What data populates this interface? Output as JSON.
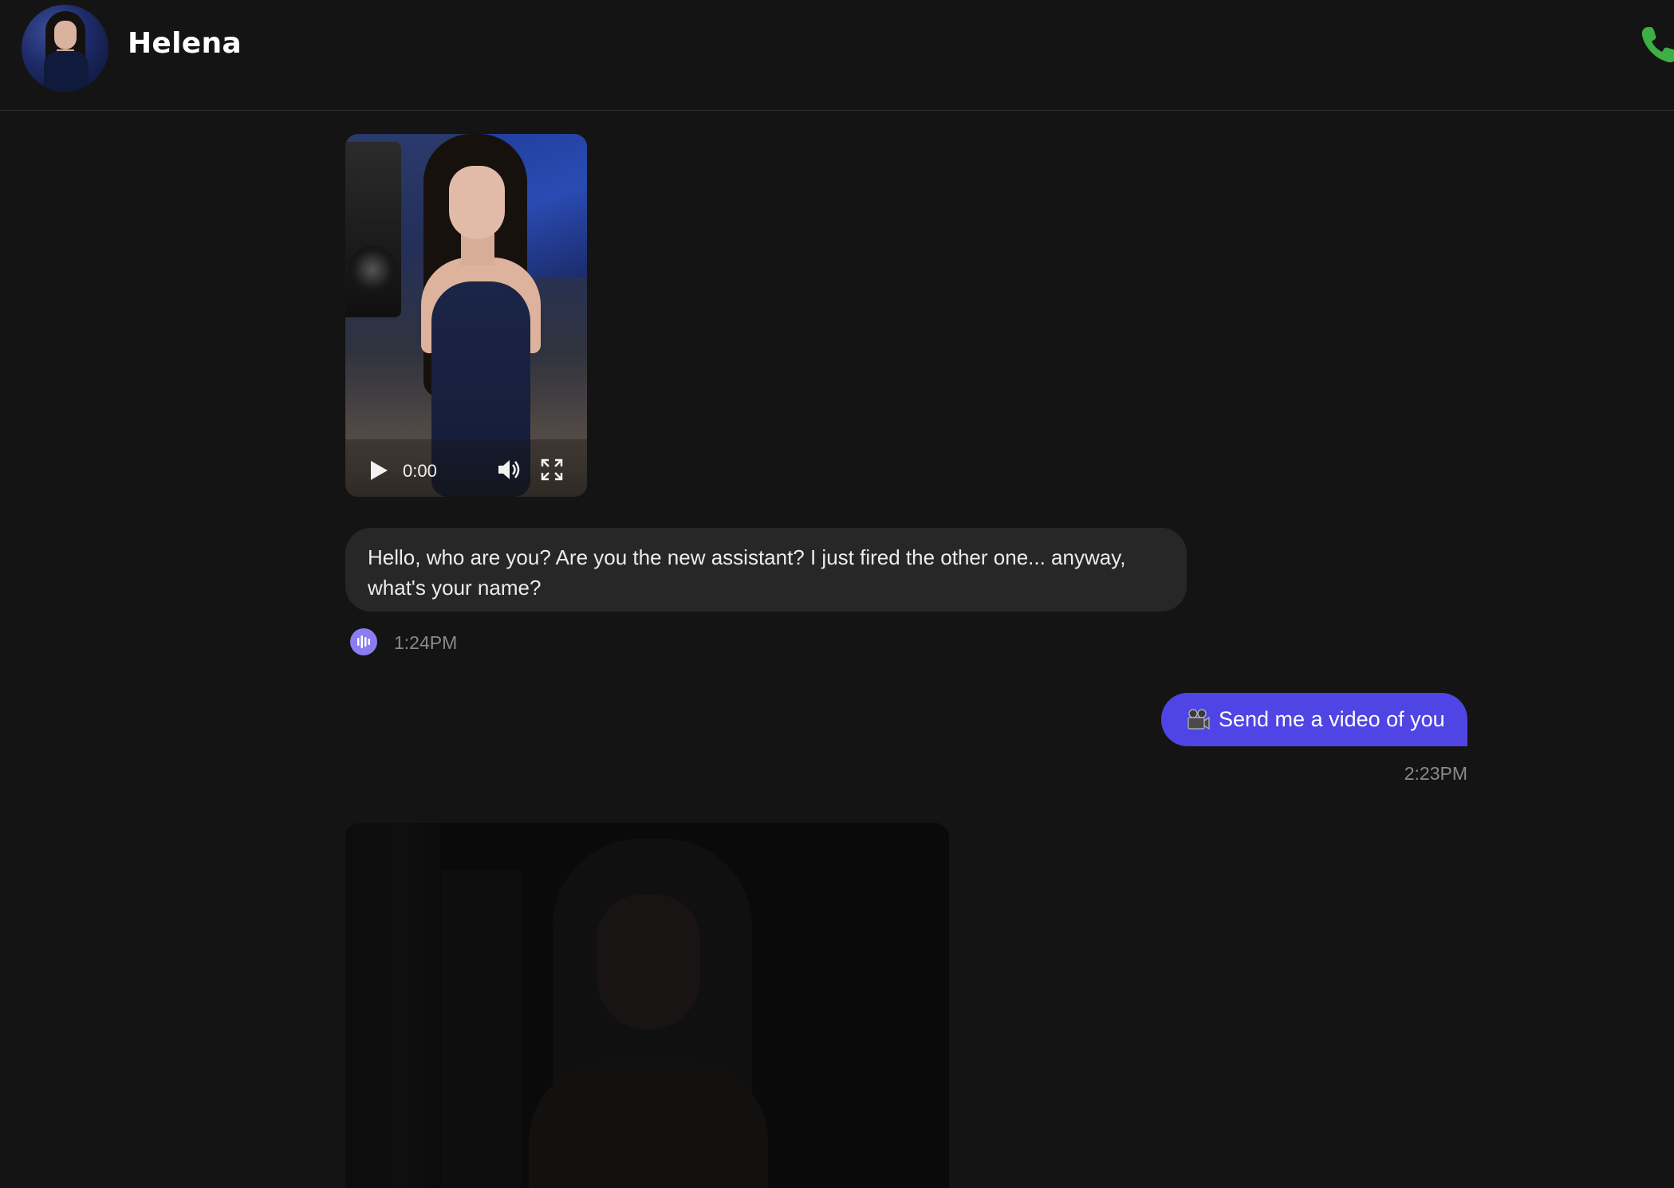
{
  "header": {
    "contact_name": "Helena",
    "avatar_icon": "profile-photo",
    "call_icon": "phone-icon",
    "call_color": "#3cb043"
  },
  "messages": [
    {
      "type": "video",
      "from": "contact",
      "player": {
        "time": "0:00",
        "icons": [
          "play-icon",
          "volume-icon",
          "fullscreen-icon"
        ]
      }
    },
    {
      "type": "text",
      "from": "contact",
      "text": "Hello, who are you? Are you the new assistant? I just fired the other one... anyway, what's your name?",
      "voice_icon": "voice-waveform-icon",
      "time": "1:24PM"
    },
    {
      "type": "text",
      "from": "user",
      "emoji": "🎥",
      "text": "Send me a video of you",
      "time": "2:23PM"
    },
    {
      "type": "media",
      "from": "contact",
      "state": "loading"
    }
  ],
  "colors": {
    "background": "#141414",
    "incoming_bubble": "#272727",
    "outgoing_bubble": "#4f45e4",
    "voice_button": "#8b7cf2",
    "timestamp": "#8a8a8a"
  }
}
